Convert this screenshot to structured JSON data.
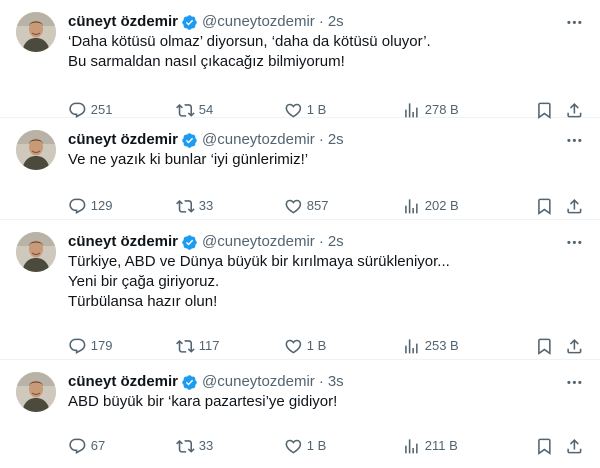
{
  "tweets": [
    {
      "name": "cüneyt özdemir",
      "handle": "@cuneytozdemir",
      "separator": "·",
      "time": "2s",
      "lines": [
        "‘Daha kötüsü olmaz’ diyorsun, ‘daha da kötüsü oluyor’.",
        "Bu sarmaldan nasıl çıkacağız bilmiyorum!"
      ],
      "replies": "251",
      "retweets": "54",
      "likes": "1 B",
      "views": "278 B"
    },
    {
      "name": "cüneyt özdemir",
      "handle": "@cuneytozdemir",
      "separator": "·",
      "time": "2s",
      "lines": [
        "Ve ne yazık ki bunlar ‘iyi günlerimiz!’"
      ],
      "replies": "129",
      "retweets": "33",
      "likes": "857",
      "views": "202 B"
    },
    {
      "name": "cüneyt özdemir",
      "handle": "@cuneytozdemir",
      "separator": "·",
      "time": "2s",
      "lines": [
        "Türkiye, ABD ve Dünya büyük bir kırılmaya sürükleniyor...",
        "Yeni bir çağa giriyoruz.",
        "Türbülansa hazır olun!"
      ],
      "replies": "179",
      "retweets": "117",
      "likes": "1 B",
      "views": "253 B"
    },
    {
      "name": "cüneyt özdemir",
      "handle": "@cuneytozdemir",
      "separator": "·",
      "time": "3s",
      "lines": [
        "ABD büyük bir ‘kara pazartesi’ye gidiyor!"
      ],
      "replies": "67",
      "retweets": "33",
      "likes": "1 B",
      "views": "211 B"
    }
  ],
  "colors": {
    "text": "#0f1419",
    "secondary": "#536471",
    "verified": "#1d9bf0",
    "divider": "#eff3f4"
  },
  "icons": {
    "verified": "verified-badge-icon",
    "more": "more-icon",
    "reply": "reply-icon",
    "retweet": "retweet-icon",
    "like": "heart-icon",
    "views": "views-icon",
    "bookmark": "bookmark-icon",
    "share": "share-icon"
  }
}
